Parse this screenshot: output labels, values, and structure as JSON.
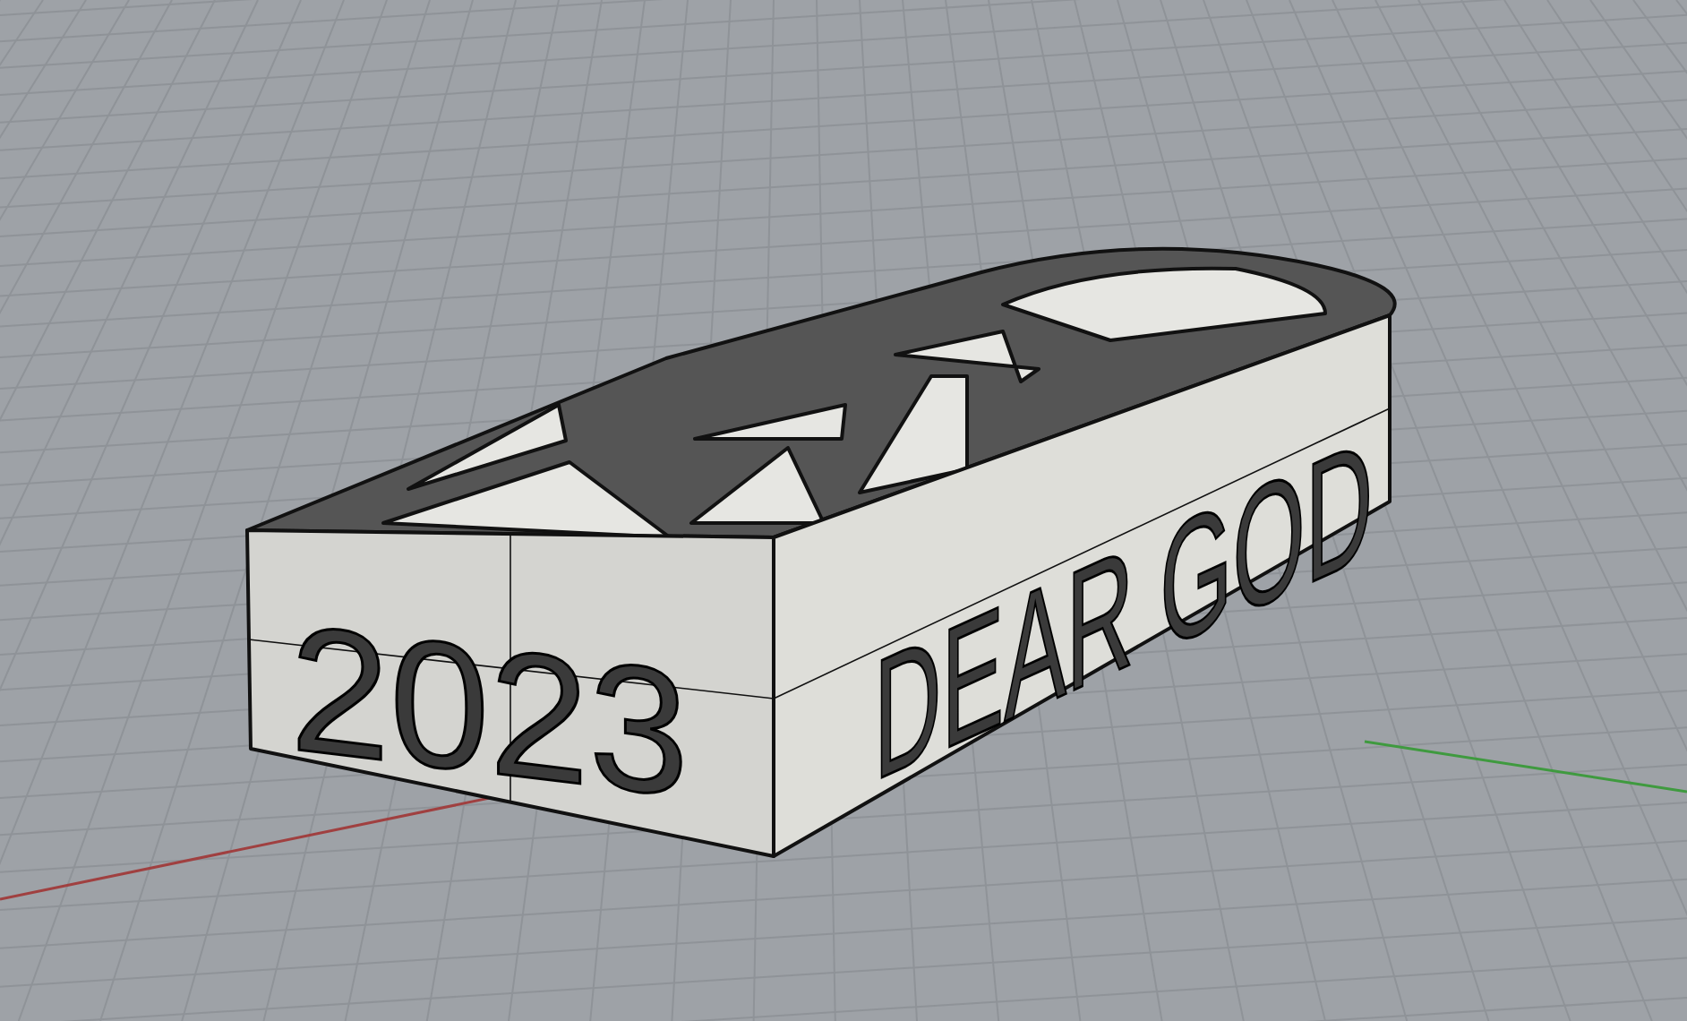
{
  "viewport": {
    "model": {
      "front_text": "2023",
      "side_text": "DEAR GOD"
    }
  }
}
